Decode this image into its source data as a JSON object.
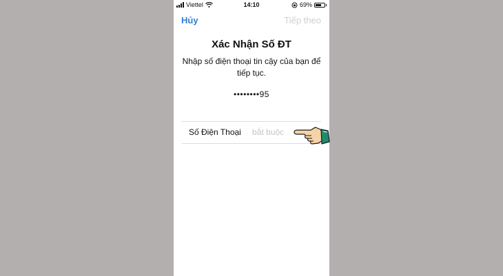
{
  "status_bar": {
    "carrier": "Viettel",
    "time": "14:10",
    "battery": "69%",
    "battery_level": 0.69
  },
  "nav": {
    "cancel_label": "Hủy",
    "next_label": "Tiếp theo"
  },
  "content": {
    "title": "Xác Nhận Số ĐT",
    "subtitle": "Nhập số điện thoại tin cậy của bạn để tiếp tục.",
    "masked_number": "••••••••95"
  },
  "phone_field": {
    "label": "Số Điện Thoại",
    "placeholder": "bắt buộc",
    "value": ""
  },
  "icons": {
    "pointer": "pointing-hand-icon",
    "wifi": "wifi-icon",
    "signal": "signal-icon",
    "battery": "battery-icon",
    "orientation_lock": "orientation-lock-icon"
  },
  "colors": {
    "background": "#b3afae",
    "accent": "#2f7fd0",
    "disabled": "#cfcfd3",
    "cuff": "#1e8a6e"
  }
}
